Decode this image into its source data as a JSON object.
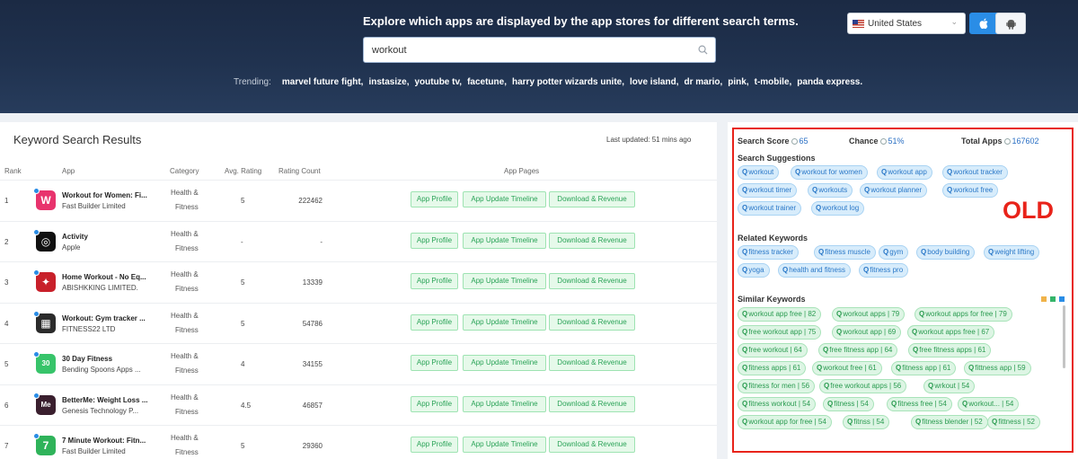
{
  "header": {
    "title": "Explore which apps are displayed by the app stores for different search terms.",
    "search_value": "workout",
    "trending_label": "Trending:",
    "trending": [
      "marvel future fight,",
      "instasize,",
      "youtube tv,",
      "facetune,",
      "harry potter wizards unite,",
      "love island,",
      "dr mario,",
      "pink,",
      "t-mobile,",
      "panda express."
    ],
    "country": "United States"
  },
  "results": {
    "title": "Keyword Search Results",
    "last_updated": "Last updated: 51 mins ago",
    "columns": {
      "rank": "Rank",
      "app": "App",
      "category": "Category",
      "avg_rating": "Avg. Rating",
      "rating_count": "Rating Count",
      "app_pages": "App Pages"
    },
    "buttons": {
      "profile": "App Profile",
      "timeline": "App Update Timeline",
      "download": "Download & Revenue"
    },
    "rows": [
      {
        "rank": "1",
        "name": "Workout for Women: Fi...",
        "developer": "Fast Builder Limited",
        "cat1": "Health &",
        "cat2": "Fitness",
        "rating": "5",
        "count": "222462",
        "icon_color": "#e8336d",
        "icon_glyph": "W"
      },
      {
        "rank": "2",
        "name": "Activity",
        "developer": "Apple",
        "cat1": "Health &",
        "cat2": "Fitness",
        "rating": "-",
        "count": "-",
        "icon_color": "#111111",
        "icon_glyph": "◎"
      },
      {
        "rank": "3",
        "name": "Home Workout - No Eq...",
        "developer": "ABISHKKING LIMITED.",
        "cat1": "Health &",
        "cat2": "Fitness",
        "rating": "5",
        "count": "13339",
        "icon_color": "#c8202a",
        "icon_glyph": "✦"
      },
      {
        "rank": "4",
        "name": "Workout: Gym tracker ...",
        "developer": "FITNESS22 LTD",
        "cat1": "Health &",
        "cat2": "Fitness",
        "rating": "5",
        "count": "54786",
        "icon_color": "#2b2b2b",
        "icon_glyph": "▦"
      },
      {
        "rank": "5",
        "name": "30 Day Fitness",
        "developer": "Bending Spoons Apps ...",
        "cat1": "Health &",
        "cat2": "Fitness",
        "rating": "4",
        "count": "34155",
        "icon_color": "#37c46a",
        "icon_glyph": "30"
      },
      {
        "rank": "6",
        "name": "BetterMe: Weight Loss ...",
        "developer": "Genesis Technology P...",
        "cat1": "Health &",
        "cat2": "Fitness",
        "rating": "4.5",
        "count": "46857",
        "icon_color": "#3a1f2e",
        "icon_glyph": "Me"
      },
      {
        "rank": "7",
        "name": "7 Minute Workout: Fitn...",
        "developer": "Fast Builder Limited",
        "cat1": "Health &",
        "cat2": "Fitness",
        "rating": "5",
        "count": "29360",
        "icon_color": "#2fb35a",
        "icon_glyph": "7"
      }
    ]
  },
  "side": {
    "search_score_label": "Search Score",
    "search_score": "65",
    "chance_label": "Chance",
    "chance": "51%",
    "total_apps_label": "Total Apps",
    "total_apps": "167602",
    "suggestions_title": "Search Suggestions",
    "suggestions": [
      "workout",
      "workout for women",
      "workout app",
      "workout tracker",
      "workout timer",
      "workouts",
      "workout planner",
      "workout free",
      "workout trainer",
      "workout log"
    ],
    "related_title": "Related Keywords",
    "related": [
      "fitness tracker",
      "fitness muscle",
      "gym",
      "body building",
      "weight lifting",
      "yoga",
      "health and fitness",
      "fitness pro"
    ],
    "similar_title": "Similar Keywords",
    "similar": [
      "workout app free | 82",
      "workout apps | 79",
      "workout apps for free | 79",
      "free workout app | 75",
      "workout app | 69",
      "workout apps free | 67",
      "free workout | 64",
      "free fitness app | 64",
      "free fitness apps | 61",
      "fitness apps | 61",
      "workout free | 61",
      "fitness app | 61",
      "fittness app | 59",
      "fitness for men | 56",
      "free workout apps | 56",
      "wrkout | 54",
      "fitness workout | 54",
      "fitness | 54",
      "fitness free | 54",
      "workout... | 54",
      "workout app for free | 54",
      "fitnss | 54",
      "fitness blender | 52",
      "fittness | 52"
    ],
    "old_label": "OLD",
    "colors": {
      "blue": "#2a78c8",
      "green": "#2a9b50",
      "red": "#e8231a"
    }
  }
}
